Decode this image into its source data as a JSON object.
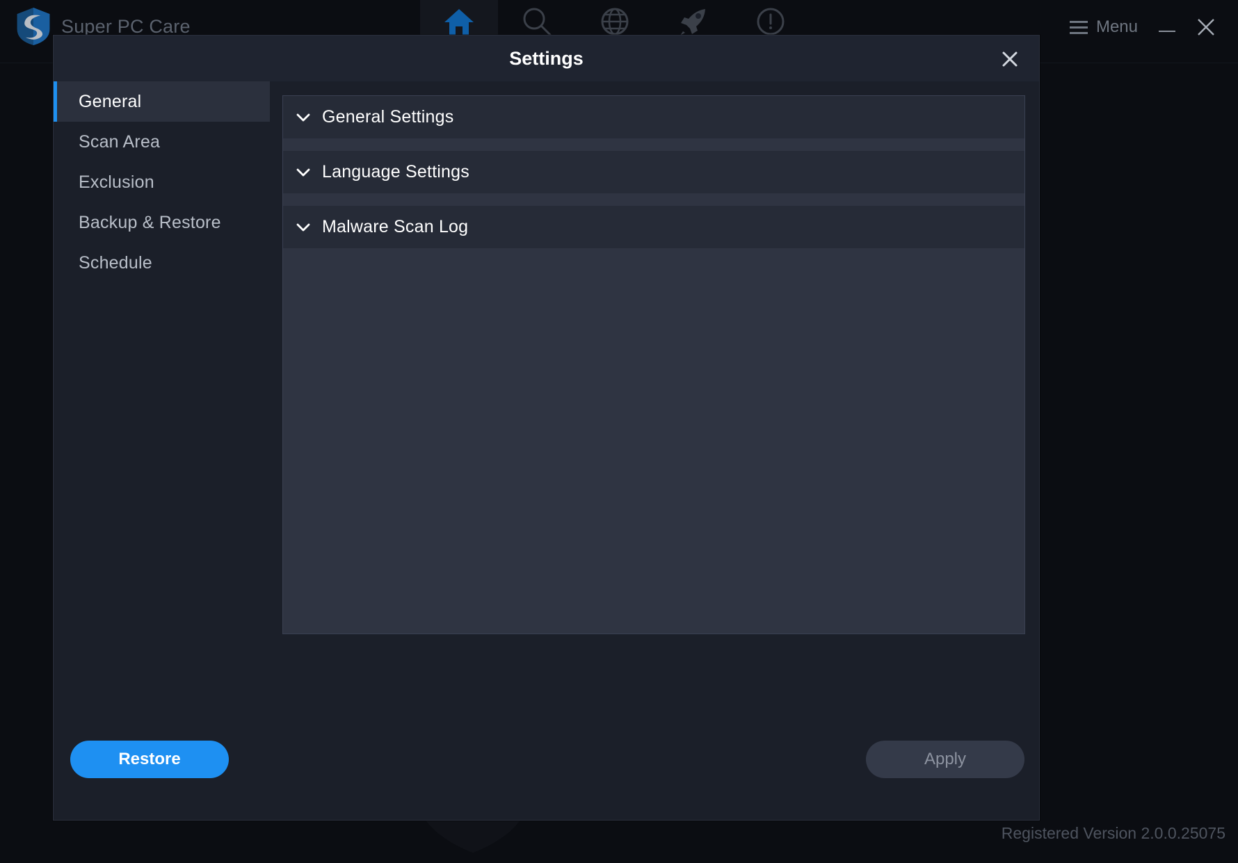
{
  "app": {
    "title": "Super PC Care",
    "logo_icon": "shield-s-logo"
  },
  "topbar": {
    "tabs": [
      {
        "name": "home",
        "icon": "home-icon",
        "active": true
      },
      {
        "name": "scan",
        "icon": "search-icon",
        "active": false
      },
      {
        "name": "web",
        "icon": "globe-icon",
        "active": false
      },
      {
        "name": "boost",
        "icon": "rocket-icon",
        "active": false
      },
      {
        "name": "alerts",
        "icon": "exclamation-circle-icon",
        "active": false
      }
    ],
    "menu_label": "Menu",
    "menu_icon": "hamburger-icon",
    "minimize_icon": "minimize-icon",
    "close_icon": "close-icon"
  },
  "dialog": {
    "title": "Settings",
    "close_icon": "close-icon",
    "sidebar": {
      "items": [
        {
          "label": "General",
          "active": true
        },
        {
          "label": "Scan Area",
          "active": false
        },
        {
          "label": "Exclusion",
          "active": false
        },
        {
          "label": "Backup & Restore",
          "active": false
        },
        {
          "label": "Schedule",
          "active": false
        }
      ]
    },
    "sections": [
      {
        "label": "General Settings",
        "expanded": false,
        "chevron_icon": "chevron-down-icon"
      },
      {
        "label": "Language Settings",
        "expanded": false,
        "chevron_icon": "chevron-down-icon"
      },
      {
        "label": "Malware Scan Log",
        "expanded": false,
        "chevron_icon": "chevron-down-icon"
      }
    ],
    "footer": {
      "restore_label": "Restore",
      "apply_label": "Apply"
    }
  },
  "status": {
    "version_text": "Registered Version 2.0.0.25075"
  },
  "colors": {
    "accent_blue": "#1e90f2",
    "dialog_bg": "#1d212b",
    "panel_bg": "#2f3442",
    "section_header_bg": "#262b37",
    "sidebar_active_bg": "#2b303d",
    "window_bg": "#0b0d12"
  }
}
